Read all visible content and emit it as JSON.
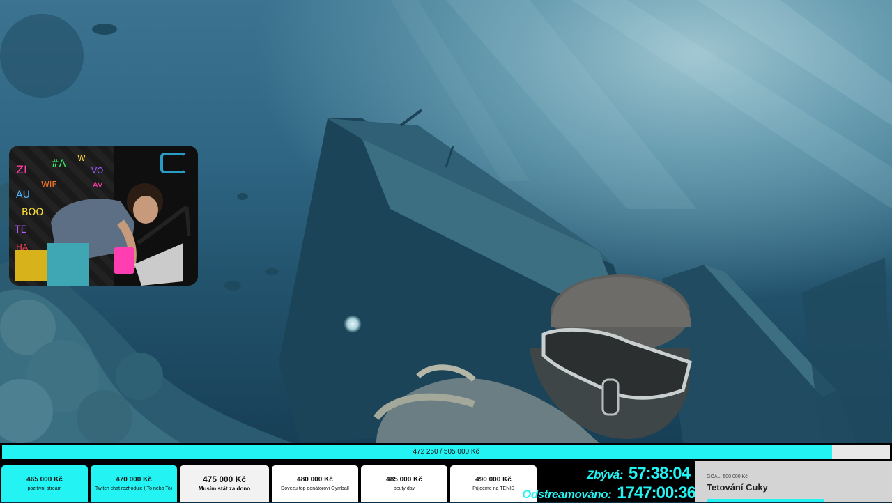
{
  "progress": {
    "label": "472 250 / 505 000 Kč",
    "fraction": 0.935
  },
  "goals": [
    {
      "amount": "465 000 Kč",
      "desc": "pozitivní stream",
      "state": "done"
    },
    {
      "amount": "470 000 Kč",
      "desc": "Twitch chat rozhoduje ( To nebo To)",
      "state": "done"
    },
    {
      "amount": "475 000 Kč",
      "desc": "Musím stát za dono",
      "state": "active"
    },
    {
      "amount": "480 000 Kč",
      "desc": "Dovezu top donátorovi Gymball",
      "state": "pending"
    },
    {
      "amount": "485 000 Kč",
      "desc": "beuty day",
      "state": "pending"
    },
    {
      "amount": "490 000 Kč",
      "desc": "Půjdeme na TENIS",
      "state": "pending"
    }
  ],
  "timers": {
    "remaining_label": "Zbývá:",
    "remaining_value": "57:38:04",
    "streamed_label": "Odstreamováno:",
    "streamed_value": "1747:00:36"
  },
  "goal_box": {
    "small": "GOAL: 500 000 Kč",
    "title": "Tetování Cuky"
  },
  "colors": {
    "accent": "#24f3f3",
    "strip_bg": "#000000",
    "goal_box_bg": "#d4d4d4"
  },
  "icons": {
    "webcam_logo": "channel-logo-icon"
  }
}
